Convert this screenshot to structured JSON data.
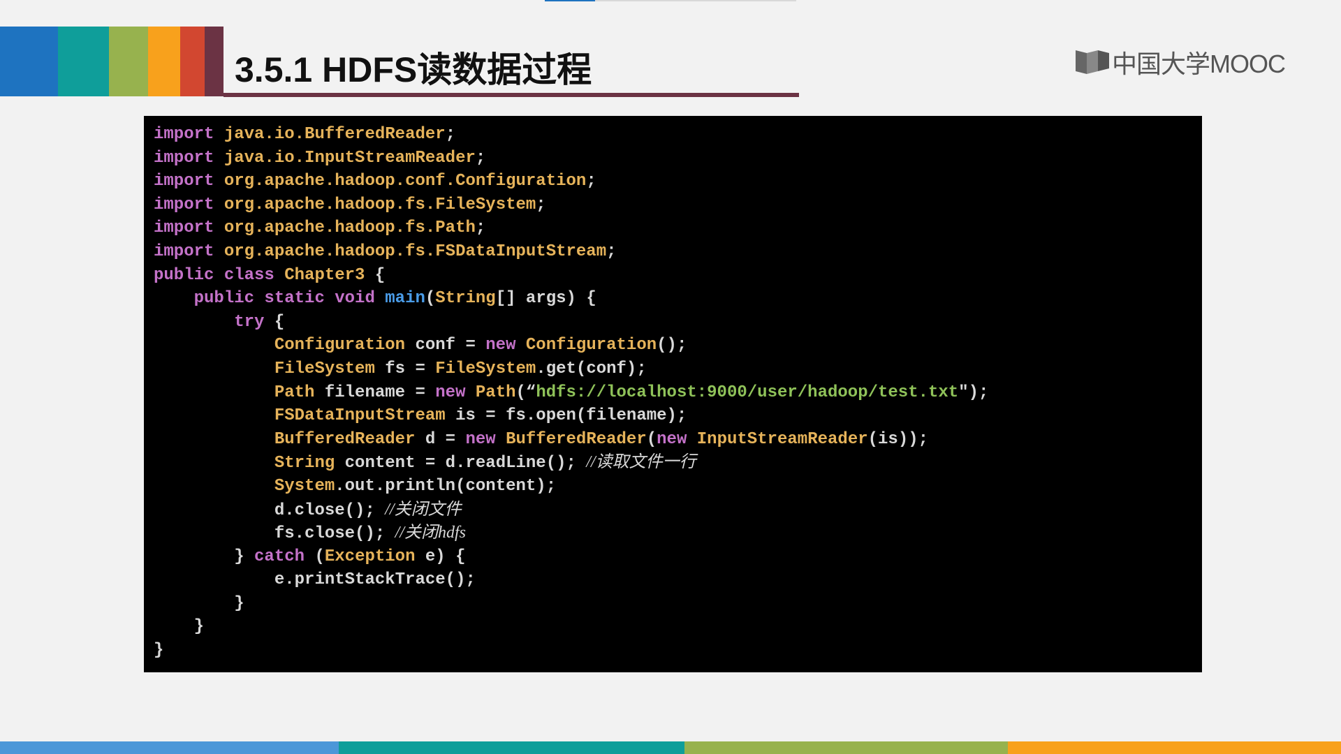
{
  "slide": {
    "title": "3.5.1 HDFS读数据过程",
    "logo_text": "中国大学MOOC",
    "logo_icon": "mooc-book-icon",
    "header_colors": [
      "#1e73c0",
      "#0f9e9a",
      "#97b24e",
      "#f8a11c",
      "#d24730",
      "#6b3344"
    ],
    "footer_colors": [
      "#4b97d8",
      "#0f9e9a",
      "#97b24e",
      "#f8a11c"
    ]
  },
  "code": {
    "language": "java",
    "lines": [
      [
        {
          "t": "import",
          "c": "kw"
        },
        {
          "t": " java.io.BufferedReader",
          "c": "ty"
        },
        {
          "t": ";",
          "c": "pl"
        }
      ],
      [
        {
          "t": "import",
          "c": "kw"
        },
        {
          "t": " java.io.InputStreamReader",
          "c": "ty"
        },
        {
          "t": ";",
          "c": "pl"
        }
      ],
      [
        {
          "t": "import",
          "c": "kw"
        },
        {
          "t": " org.apache.hadoop.conf.Configuration",
          "c": "ty"
        },
        {
          "t": ";",
          "c": "pl"
        }
      ],
      [
        {
          "t": "import",
          "c": "kw"
        },
        {
          "t": " org.apache.hadoop.fs.FileSystem",
          "c": "ty"
        },
        {
          "t": ";",
          "c": "pl"
        }
      ],
      [
        {
          "t": "import",
          "c": "kw"
        },
        {
          "t": " org.apache.hadoop.fs.Path",
          "c": "ty"
        },
        {
          "t": ";",
          "c": "pl"
        }
      ],
      [
        {
          "t": "import",
          "c": "kw"
        },
        {
          "t": " org.apache.hadoop.fs.FSDataInputStream",
          "c": "ty"
        },
        {
          "t": ";",
          "c": "pl"
        }
      ],
      [
        {
          "t": "public class",
          "c": "kw"
        },
        {
          "t": " Chapter3",
          "c": "ty"
        },
        {
          "t": " {",
          "c": "pl"
        }
      ],
      [
        {
          "t": "    public static void",
          "c": "kw"
        },
        {
          "t": " main",
          "c": "fn"
        },
        {
          "t": "(",
          "c": "pl"
        },
        {
          "t": "String",
          "c": "ty"
        },
        {
          "t": "[] args) {",
          "c": "pl"
        }
      ],
      [
        {
          "t": "        try",
          "c": "kw"
        },
        {
          "t": " {",
          "c": "pl"
        }
      ],
      [
        {
          "t": "            Configuration",
          "c": "ty"
        },
        {
          "t": " conf = ",
          "c": "pl"
        },
        {
          "t": "new",
          "c": "kw"
        },
        {
          "t": " Configuration",
          "c": "ty"
        },
        {
          "t": "();",
          "c": "pl"
        }
      ],
      [
        {
          "t": "            FileSystem",
          "c": "ty"
        },
        {
          "t": " fs = ",
          "c": "pl"
        },
        {
          "t": "FileSystem",
          "c": "ty"
        },
        {
          "t": ".get(conf);",
          "c": "pl"
        }
      ],
      [
        {
          "t": "            Path",
          "c": "ty"
        },
        {
          "t": " filename = ",
          "c": "pl"
        },
        {
          "t": "new",
          "c": "kw"
        },
        {
          "t": " Path",
          "c": "ty"
        },
        {
          "t": "(“",
          "c": "pl"
        },
        {
          "t": "hdfs://localhost:9000/user/hadoop/test.txt",
          "c": "st"
        },
        {
          "t": "\");",
          "c": "pl"
        }
      ],
      [
        {
          "t": "            FSDataInputStream",
          "c": "ty"
        },
        {
          "t": " is = fs.open(filename);",
          "c": "pl"
        }
      ],
      [
        {
          "t": "            BufferedReader",
          "c": "ty"
        },
        {
          "t": " d = ",
          "c": "pl"
        },
        {
          "t": "new",
          "c": "kw"
        },
        {
          "t": " BufferedReader",
          "c": "ty"
        },
        {
          "t": "(",
          "c": "pl"
        },
        {
          "t": "new",
          "c": "kw"
        },
        {
          "t": " InputStreamReader",
          "c": "ty"
        },
        {
          "t": "(is));",
          "c": "pl"
        }
      ],
      [
        {
          "t": "            String",
          "c": "ty"
        },
        {
          "t": " content = d.readLine(); ",
          "c": "pl"
        },
        {
          "t": "//读取文件一行",
          "c": "cm"
        }
      ],
      [
        {
          "t": "            System",
          "c": "ty"
        },
        {
          "t": ".out.println(content);",
          "c": "pl"
        }
      ],
      [
        {
          "t": "            d.close(); ",
          "c": "pl"
        },
        {
          "t": "//关闭文件",
          "c": "cm"
        }
      ],
      [
        {
          "t": "            fs.close(); ",
          "c": "pl"
        },
        {
          "t": "//关闭hdfs",
          "c": "cm"
        }
      ],
      [
        {
          "t": "        } ",
          "c": "pl"
        },
        {
          "t": "catch",
          "c": "kw"
        },
        {
          "t": " (",
          "c": "pl"
        },
        {
          "t": "Exception",
          "c": "ty"
        },
        {
          "t": " e) {",
          "c": "pl"
        }
      ],
      [
        {
          "t": "            e.printStackTrace();",
          "c": "pl"
        }
      ],
      [
        {
          "t": "        }",
          "c": "pl"
        }
      ],
      [
        {
          "t": "    }",
          "c": "pl"
        }
      ],
      [
        {
          "t": "}",
          "c": "pl"
        }
      ]
    ]
  }
}
